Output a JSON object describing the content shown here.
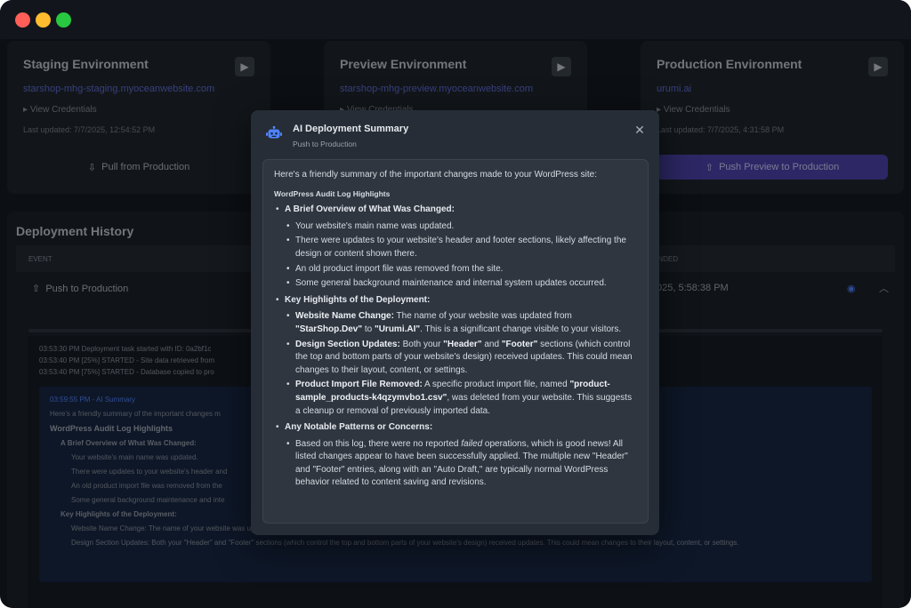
{
  "environments": [
    {
      "title": "Staging Environment",
      "url": "starshop-mhg-staging.myoceanwebsite.com",
      "credentials": "View Credentials",
      "updated": "Last updated: 7/7/2025, 12:54:52 PM",
      "button": "Pull from Production"
    },
    {
      "title": "Preview Environment",
      "url": "starshop-mhg-preview.myoceanwebsite.com",
      "credentials": "View Credentials",
      "updated": "",
      "button": ""
    },
    {
      "title": "Production Environment",
      "url": "urumi.ai",
      "credentials": "View Credentials",
      "updated": "Last updated: 7/7/2025, 4:31:58 PM",
      "button": "Push Preview to Production"
    }
  ],
  "history": {
    "title": "Deployment History",
    "col_event": "EVENT",
    "col_date": "ENDED",
    "row_event": "Push to Production",
    "row_date": "025, 5:58:38 PM",
    "logs": [
      "03:53:30 PM  Deployment task started with ID: 0a2bf1c",
      "03:53:40 PM  [25%] STARTED - Site data retrieved from",
      "03:53:40 PM  [75%] STARTED - Database copied to pro"
    ],
    "ai_head": "03:59:55 PM - AI Summary",
    "ai_lines": [
      "Here's a friendly summary of the important changes m",
      "WordPress Audit Log Highlights",
      "A Brief Overview of What Was Changed:",
      "Your website's main name was updated.",
      "There were updates to your website's header and",
      "An old product import file was removed from the",
      "Some general background maintenance and inte",
      "Key Highlights of the Deployment:",
      "Website Name Change: The name of your website was updated from \"StarShop.Dev\" to \"Urumi.AI\". This is a significant change visible to your visitors.",
      "Design Section Updates: Both your \"Header\" and \"Footer\" sections (which control the top and bottom parts of your website's design) received updates. This could mean changes to their layout, content, or settings."
    ]
  },
  "modal": {
    "title": "AI Deployment Summary",
    "subtitle": "Push to Production",
    "intro": "Here's a friendly summary of the important changes made to your WordPress site:",
    "heading": "WordPress Audit Log Highlights",
    "s1_title": "A Brief Overview of What Was Changed:",
    "s1_items": [
      "Your website's main name was updated.",
      "There were updates to your website's header and footer sections, likely affecting the design or content shown there.",
      "An old product import file was removed from the site.",
      "Some general background maintenance and internal system updates occurred."
    ],
    "s2_title": "Key Highlights of the Deployment:",
    "s2_i1_label": "Website Name Change:",
    "s2_i1_text_a": " The name of your website was updated from ",
    "s2_i1_old": "\"StarShop.Dev\"",
    "s2_i1_to": " to ",
    "s2_i1_new": "\"Urumi.AI\"",
    "s2_i1_text_b": ". This is a significant change visible to your visitors.",
    "s2_i2_label": "Design Section Updates:",
    "s2_i2_text_a": " Both your ",
    "s2_i2_header": "\"Header\"",
    "s2_i2_and": " and ",
    "s2_i2_footer": "\"Footer\"",
    "s2_i2_text_b": " sections (which control the top and bottom parts of your website's design) received updates. This could mean changes to their layout, content, or settings.",
    "s2_i3_label": "Product Import File Removed:",
    "s2_i3_text_a": " A specific product import file, named ",
    "s2_i3_file": "\"product-sample_products-k4qzymvbo1.csv\"",
    "s2_i3_text_b": ", was deleted from your website. This suggests a cleanup or removal of previously imported data.",
    "s3_title": "Any Notable Patterns or Concerns:",
    "s3_text_a": "Based on this log, there were no reported ",
    "s3_failed": "failed",
    "s3_text_b": " operations, which is good news! All listed changes appear to have been successfully applied. The multiple new \"Header\" and \"Footer\" entries, along with an \"Auto Draft,\" are typically normal WordPress behavior related to content saving and revisions."
  },
  "colors": {
    "accent": "#4f82ff",
    "primary_button": "#4b3fae",
    "window_bg": "#0f1318",
    "modal_bg": "#262d36"
  },
  "icons": {
    "robot": "robot-icon",
    "close": "close-icon",
    "deploy": "deploy-icon"
  }
}
